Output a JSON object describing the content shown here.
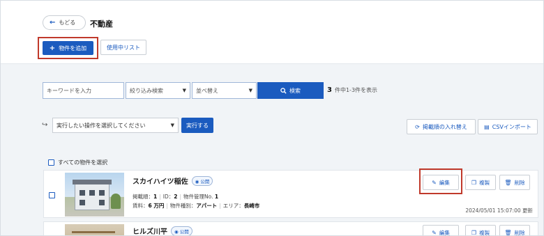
{
  "header": {
    "back_label": "もどる",
    "title": "不動産",
    "add_label": "物件を追加",
    "inuse_label": "使用中リスト"
  },
  "search": {
    "keyword_placeholder": "キーワードを入力",
    "filter_label": "絞り込み検索",
    "sort_label": "並べ替え",
    "search_label": "検索",
    "result_count": "3",
    "result_text": "件中1-3件を表示"
  },
  "bulk": {
    "select_label": "実行したい操作を選択してください",
    "execute_label": "実行する",
    "reorder_label": "掲載順の入れ替え",
    "csv_label": "CSVインポート"
  },
  "list": {
    "select_all_label": "すべての物件を選択",
    "items": [
      {
        "title": "スカイハイツ稲佐",
        "badge": "公開",
        "order_label": "掲載順：",
        "order": "1",
        "id_label": "ID：",
        "id": "2",
        "mgmt_label": "物件管理No.",
        "mgmt": "1",
        "rent_label": "賃料：",
        "rent": "6 万円",
        "type_label": "物件種別：",
        "type": "アパート",
        "area_label": "エリア：",
        "area": "長崎市",
        "updated": "2024/05/01 15:07:00 更新"
      },
      {
        "title": "ヒルズ川平",
        "badge": "公開"
      }
    ],
    "edit_label": "編集",
    "copy_label": "複製",
    "delete_label": "削除"
  },
  "icons": {
    "back": "arrow-left-icon",
    "add": "plus-icon",
    "search": "search-icon",
    "bulk": "share-arrow-icon",
    "reorder": "sync-icon",
    "csv": "document-icon",
    "edit": "edit-icon",
    "copy": "copy-icon",
    "delete": "trash-icon",
    "public": "eye-icon"
  },
  "colors": {
    "primary": "#1b5bbf",
    "highlight": "#c0392b",
    "background": "#f1f4f7"
  }
}
